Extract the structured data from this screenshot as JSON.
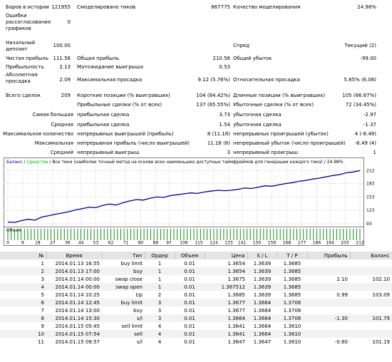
{
  "stats": {
    "bars_label": "Баров в истории",
    "bars_value": "121955",
    "ticks_label": "Смоделировано тиков",
    "ticks_value": "867775",
    "quality_label": "Качество моделирования",
    "quality_value": "24.98%",
    "errors_label": "Ошибки рассогласования графиков",
    "errors_value": "0",
    "deposit_label": "Начальный депозит",
    "deposit_value": "100.00",
    "spread_label": "Спред",
    "spread_value": "Текущий (2)",
    "net_profit_label": "Чистая прибыль",
    "net_profit_value": "111.56",
    "gross_profit_label": "Общая прибыль",
    "gross_profit_value": "210.56",
    "gross_loss_label": "Общий убыток",
    "gross_loss_value": "-99.00",
    "profit_factor_label": "Прибыльность",
    "profit_factor_value": "2.13",
    "expected_payoff_label": "Матожидание выигрыша",
    "expected_payoff_value": "0.53",
    "abs_dd_label": "Абсолютная просадка",
    "abs_dd_value": "2.09",
    "max_dd_label": "Максимальная просадка",
    "max_dd_value": "9.12 (5.76%)",
    "rel_dd_label": "Относительная просадка",
    "rel_dd_value": "5.85% (6.08)",
    "total_trades_label": "Всего сделок",
    "total_trades_value": "209",
    "short_label": "Короткие позиции (% выигравших)",
    "short_value": "104 (64.42%)",
    "long_label": "Длинные позиции (% выигравших)",
    "long_value": "105 (66.67%)",
    "profit_trades_label": "Прибыльные сделки (% от всех)",
    "profit_trades_value": "137 (65.55%)",
    "loss_trades_label": "Убыточные сделки (% от всех)",
    "loss_trades_value": "72 (34.45%)",
    "largest_label": "Самая большая",
    "largest_profit_label": "прибыльная сделка",
    "largest_profit_value": "3.73",
    "largest_loss_label": "убыточная сделка",
    "largest_loss_value": "-2.97",
    "average_label": "Средняя",
    "average_profit_label": "прибыльная сделка",
    "average_profit_value": "1.54",
    "average_loss_label": "убыточная сделка",
    "average_loss_value": "-1.37",
    "max_count_label": "Максимальное количество",
    "max_cons_wins_label": "непрерывных выигрышей (прибыль)",
    "max_cons_wins_value": "8 (11.18)",
    "max_cons_losses_label": "непрерывных проигрышей (убыток)",
    "max_cons_losses_value": "4 (-6.49)",
    "maximal_label": "Максимальная",
    "max_cons_profit_label": "непрерывная прибыль (число выигрышей)",
    "max_cons_profit_value": "11.18 (8)",
    "max_cons_loss_label": "непрерывный убыток (число проигрышей)",
    "max_cons_loss_value": "-6.49 (4)",
    "avg_cons_label": "Средний",
    "avg_cons_wins_label": "непрерывный выигрыш",
    "avg_cons_wins_value": "3",
    "avg_cons_losses_label": "непрерывный проигрыш",
    "avg_cons_losses_value": "1"
  },
  "chart": {
    "header_balance": "Баланс",
    "header_sep": "/",
    "header_equity": "Средства",
    "header_rest": "/ Все тики (наиболее точный метод на основе всех наименьших доступных таймфреймов для генерации каждого тика) / 24.98%",
    "volume_label": "Объем",
    "colors": {
      "balance": "#00008b",
      "equity": "#00b000",
      "volume": "#008000",
      "grid": "#c8c8c8"
    }
  },
  "chart_data": {
    "type": "line",
    "series": [
      {
        "name": "Баланс",
        "values": [
          97,
          96,
          100,
          103,
          101,
          108,
          111,
          114,
          117,
          120,
          124,
          127,
          130,
          129,
          134,
          137,
          135,
          140,
          144,
          147,
          146,
          150,
          153,
          152,
          156,
          158,
          160,
          162,
          161,
          164,
          166,
          168,
          167,
          168,
          170,
          173,
          172,
          175,
          178,
          177,
          180,
          183,
          185,
          188,
          190,
          193,
          195,
          198,
          201,
          203,
          207,
          209,
          212
        ]
      }
    ],
    "x_min": 0,
    "x_max": 212,
    "x_ticks": [
      "0",
      "9",
      "18",
      "27",
      "36",
      "44",
      "53",
      "62",
      "71",
      "80",
      "89",
      "97",
      "106",
      "115",
      "124",
      "133",
      "141",
      "150",
      "159",
      "168",
      "177",
      "186",
      "194",
      "203",
      "212"
    ],
    "x_tick_values": [
      0,
      9,
      18,
      27,
      36,
      44,
      53,
      62,
      71,
      80,
      89,
      97,
      106,
      115,
      124,
      133,
      141,
      150,
      159,
      168,
      177,
      186,
      194,
      203,
      212
    ],
    "ylim": [
      93,
      219
    ],
    "y_ticks": [
      "212",
      "183",
      "153",
      "123",
      "93"
    ],
    "y_tick_values": [
      212,
      183,
      153,
      123,
      93
    ]
  },
  "table": {
    "headers": [
      "№",
      "Время",
      "Тип",
      "Ордер",
      "Объем",
      "Цена",
      "S / L",
      "T / P",
      "Прибыль",
      "Баланс"
    ],
    "rows": [
      [
        "1",
        "2014.01.13 16:55",
        "buy limit",
        "1",
        "0.01",
        "1.3654",
        "1.3639",
        "1.3685",
        "",
        ""
      ],
      [
        "2",
        "2014.01.13 17:00",
        "buy",
        "1",
        "0.01",
        "1.3654",
        "1.3639",
        "1.3685",
        "",
        ""
      ],
      [
        "3",
        "2014.01.14 00:00",
        "swap close",
        "1",
        "0.01",
        "1.3675",
        "1.3639",
        "1.3685",
        "2.10",
        "102.10"
      ],
      [
        "4",
        "2014.01.14 00:00",
        "swap open",
        "1",
        "0.01",
        "1.367512",
        "1.3639",
        "1.3685",
        "",
        ""
      ],
      [
        "5",
        "2014.01.14 10:25",
        "t/p",
        "2",
        "0.01",
        "1.3685",
        "1.3639",
        "1.3685",
        "0.99",
        "103.09"
      ],
      [
        "6",
        "2014.01.14 12:45",
        "buy limit",
        "3",
        "0.01",
        "1.3677",
        "1.3664",
        "1.3708",
        "",
        ""
      ],
      [
        "7",
        "2014.01.14 13:00",
        "buy",
        "3",
        "0.01",
        "1.3677",
        "1.3664",
        "1.3708",
        "",
        ""
      ],
      [
        "8",
        "2014.01.14 15:30",
        "s/l",
        "3",
        "0.01",
        "1.3664",
        "1.3664",
        "1.3708",
        "-1.30",
        "101.79"
      ],
      [
        "9",
        "2014.01.15 05:45",
        "sell limit",
        "4",
        "0.01",
        "1.3641",
        "1.3664",
        "1.3610",
        "",
        ""
      ],
      [
        "10",
        "2014.01.15 07:54",
        "sell",
        "4",
        "0.01",
        "1.3641",
        "1.3664",
        "1.3610",
        "",
        ""
      ],
      [
        "11",
        "2014.01.15 09:57",
        "s/l",
        "4",
        "0.01",
        "1.3647",
        "1.3647",
        "1.3610",
        "-0.60",
        "101.19"
      ]
    ]
  }
}
